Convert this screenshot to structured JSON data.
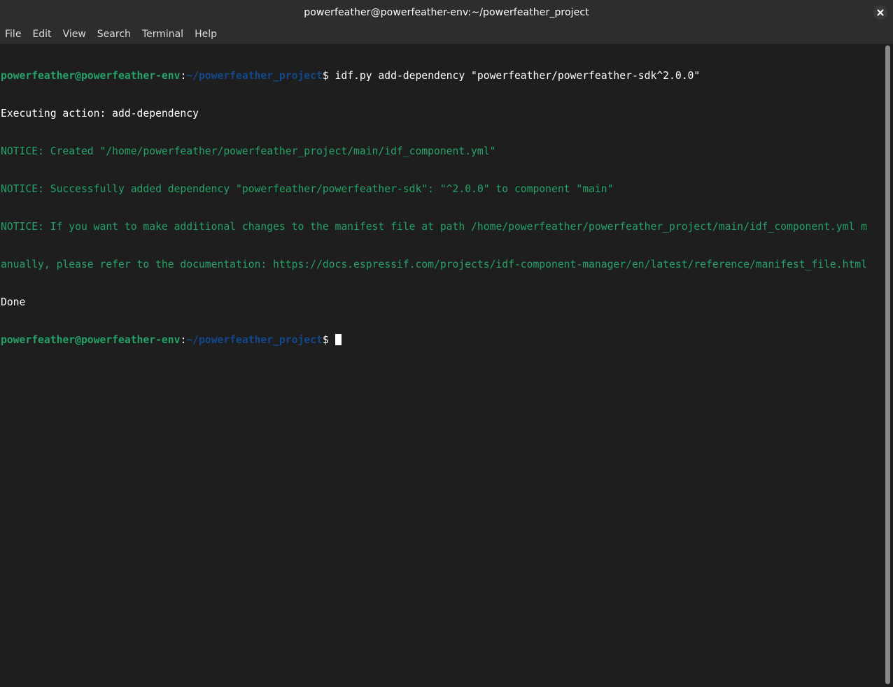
{
  "window": {
    "title": "powerfeather@powerfeather-env:~/powerfeather_project"
  },
  "menu": {
    "items": [
      "File",
      "Edit",
      "View",
      "Search",
      "Terminal",
      "Help"
    ]
  },
  "terminal": {
    "prompt_user": "powerfeather@powerfeather-env",
    "prompt_colon": ":",
    "prompt_path": "~/powerfeather_project",
    "prompt_symbol": "$",
    "command": " idf.py add-dependency \"powerfeather/powerfeather-sdk^2.0.0\"",
    "output": [
      {
        "text": "Executing action: add-dependency",
        "kind": "normal"
      },
      {
        "text": "NOTICE: Created \"/home/powerfeather/powerfeather_project/main/idf_component.yml\"",
        "kind": "notice"
      },
      {
        "text": "NOTICE: Successfully added dependency \"powerfeather/powerfeather-sdk\": \"^2.0.0\" to component \"main\"",
        "kind": "notice"
      },
      {
        "text": "NOTICE: If you want to make additional changes to the manifest file at path /home/powerfeather/powerfeather_project/main/idf_component.yml m",
        "kind": "notice"
      },
      {
        "text": "anually, please refer to the documentation: https://docs.espressif.com/projects/idf-component-manager/en/latest/reference/manifest_file.html",
        "kind": "notice"
      },
      {
        "text": "Done",
        "kind": "normal"
      }
    ]
  },
  "colors": {
    "prompt_user": "#26a269",
    "prompt_path": "#12488b",
    "notice": "#26a269",
    "background": "#1e1e1e"
  },
  "icons": {
    "close": "close-icon"
  }
}
